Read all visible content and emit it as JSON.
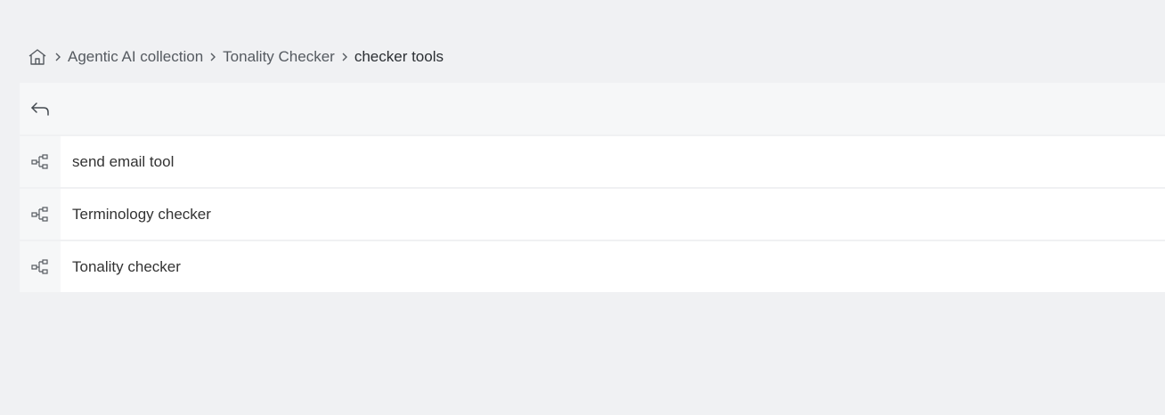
{
  "breadcrumb": {
    "home_icon": "home-icon",
    "separator_icon": "chevron-right-icon",
    "items": [
      {
        "label": "Agentic AI collection"
      },
      {
        "label": "Tonality Checker"
      },
      {
        "label": "checker tools"
      }
    ]
  },
  "toolbar": {
    "back_icon": "back-arrow-icon"
  },
  "list": {
    "item_icon": "workflow-icon",
    "items": [
      {
        "label": "send email tool"
      },
      {
        "label": "Terminology checker"
      },
      {
        "label": "Tonality checker"
      }
    ]
  },
  "colors": {
    "background": "#f0f1f3",
    "row_background": "#ffffff",
    "icon_cell_background": "#f6f7f8",
    "text": "#333333"
  }
}
